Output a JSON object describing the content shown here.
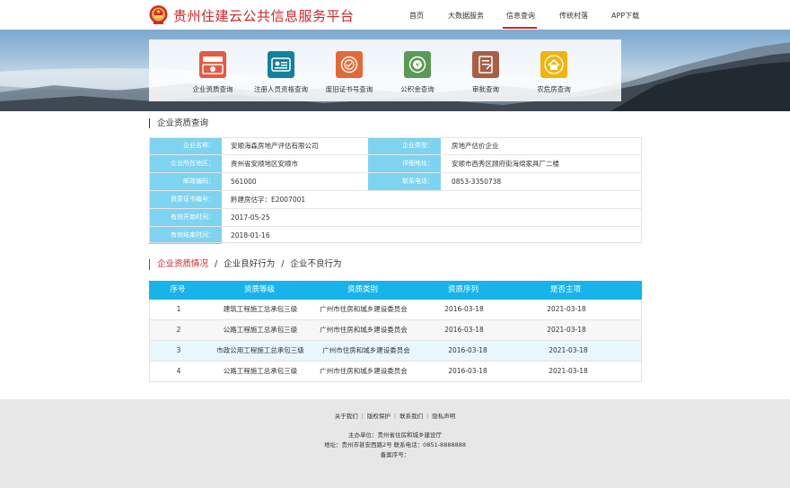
{
  "header": {
    "title": "贵州住建云公共信息服务平台",
    "nav": [
      {
        "label": "首页"
      },
      {
        "label": "大数据服务"
      },
      {
        "label": "信息查询"
      },
      {
        "label": "传统村落"
      },
      {
        "label": "APP下载"
      }
    ],
    "active_nav": "信息查询"
  },
  "tiles": [
    {
      "label": "企业资质查询",
      "icon": "enterprise-certificate-icon",
      "color": "#e8593f"
    },
    {
      "label": "注册人员资格查询",
      "icon": "id-card-icon",
      "color": "#12829a"
    },
    {
      "label": "废旧证书号查询",
      "icon": "certificate-seal-icon",
      "color": "#e26a3a"
    },
    {
      "label": "公积金查询",
      "icon": "fund-coin-icon",
      "color": "#5a9a55"
    },
    {
      "label": "审批查询",
      "icon": "approval-document-icon",
      "color": "#a85f45"
    },
    {
      "label": "农危房查询",
      "icon": "house-icon",
      "color": "#f0b410"
    }
  ],
  "section_title": "企业资质查询",
  "info": {
    "company_name_label": "企业名称：",
    "company_name": "安顺海森房地产评估有限公司",
    "company_type_label": "企业类型：",
    "company_type": "房地产估价企业",
    "region_label": "企业所在地区：",
    "region": "贵州省安顺地区安顺市",
    "address_label": "详细地址：",
    "address": "安顺市西秀区顾府街海绵家具厂二楼",
    "postcode_label": "邮政编码：",
    "postcode": "561000",
    "phone_label": "联系电话：",
    "phone": "0853-3350738",
    "cert_no_label": "资质证书编号：",
    "cert_no": "黔建房估字：E2007001",
    "valid_start_label": "有效开始时间：",
    "valid_start": "2017-05-25",
    "valid_end_label": "有效结束时间：",
    "valid_end": "2018-01-16"
  },
  "tabs": [
    {
      "label": "企业资质情况"
    },
    {
      "label": "企业良好行为"
    },
    {
      "label": "企业不良行为"
    }
  ],
  "tab_separator": "/",
  "table": {
    "columns": [
      "序号",
      "资质等级",
      "资质类别",
      "资质序列",
      "是否主项"
    ],
    "rows": [
      [
        "1",
        "建筑工程施工总承包三级",
        "广州市住房和城乡建设委员会",
        "2016-03-18",
        "2021-03-18"
      ],
      [
        "2",
        "公路工程施工总承包三级",
        "广州市住房和城乡建设委员会",
        "2016-03-18",
        "2021-03-18"
      ],
      [
        "3",
        "市政公用工程施工总承包三级",
        "广州市住房和城乡建设委员会",
        "2016-03-18",
        "2021-03-18"
      ],
      [
        "4",
        "公路工程施工总承包三级",
        "广州市住房和城乡建设委员会",
        "2016-03-18",
        "2021-03-18"
      ]
    ]
  },
  "footer": {
    "links": [
      "关于我们",
      "版权保护",
      "联系我们",
      "隐私声明"
    ],
    "link_separator": "|",
    "sponsor": "主办单位：贵州省住房和城乡建设厅",
    "contact": "地址：贵州市甚安西路2号  联系电话：0851-8888888",
    "icp": "备案序号："
  }
}
